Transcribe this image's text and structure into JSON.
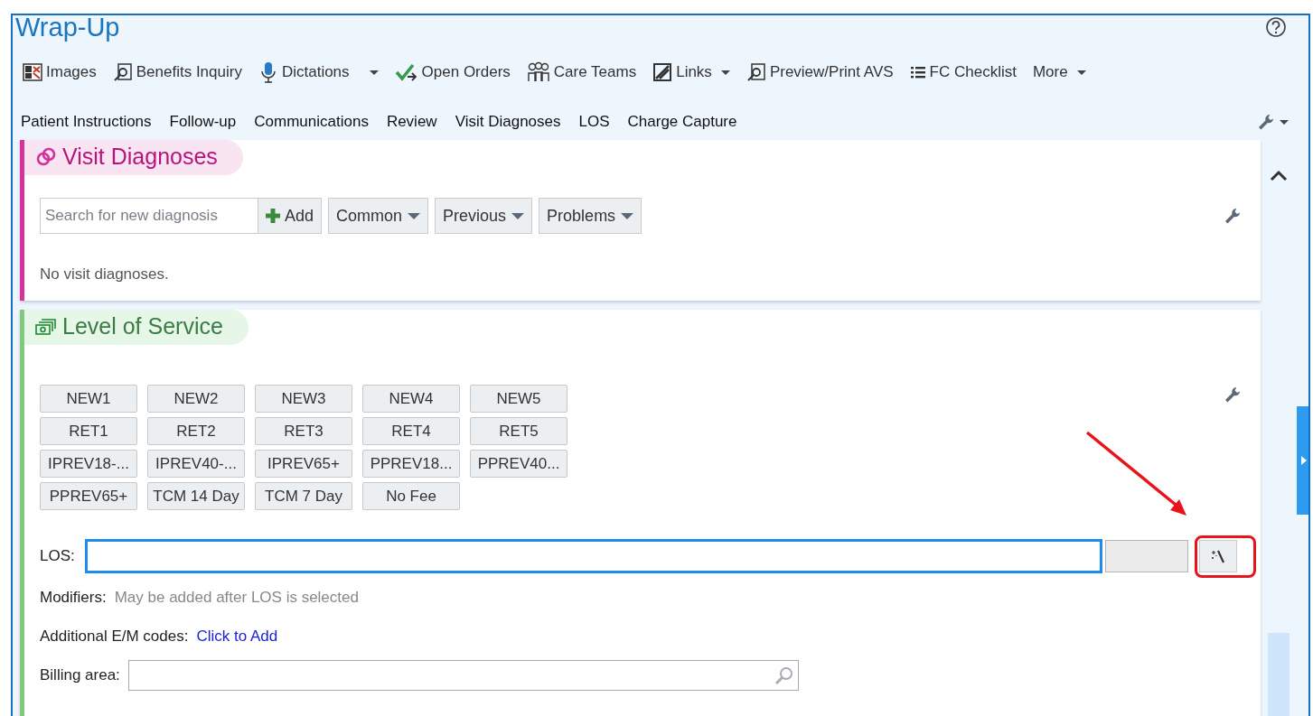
{
  "header": {
    "title": "Wrap-Up"
  },
  "toolbar": [
    {
      "label": "Images",
      "dropdown": false
    },
    {
      "label": "Benefits Inquiry",
      "dropdown": false
    },
    {
      "label": "Dictations",
      "dropdown": true
    },
    {
      "label": "Open Orders",
      "dropdown": false
    },
    {
      "label": "Care Teams",
      "dropdown": false
    },
    {
      "label": "Links",
      "dropdown": true
    },
    {
      "label": "Preview/Print AVS",
      "dropdown": false
    },
    {
      "label": "FC Checklist",
      "dropdown": false
    },
    {
      "label": "More",
      "dropdown": true
    }
  ],
  "nav_tabs": [
    "Patient Instructions",
    "Follow-up",
    "Communications",
    "Review",
    "Visit Diagnoses",
    "LOS",
    "Charge Capture"
  ],
  "visit_diagnoses": {
    "title": "Visit Diagnoses",
    "search": {
      "placeholder": "Search for new diagnosis"
    },
    "buttons": [
      {
        "label": "Add",
        "kind": "add"
      },
      {
        "label": "Common",
        "kind": "menu"
      },
      {
        "label": "Previous",
        "kind": "menu"
      },
      {
        "label": "Problems",
        "kind": "menu"
      }
    ],
    "empty_message": "No visit diagnoses."
  },
  "level_of_service": {
    "title": "Level of Service",
    "codes": [
      "NEW1",
      "NEW2",
      "NEW3",
      "NEW4",
      "NEW5",
      "RET1",
      "RET2",
      "RET3",
      "RET4",
      "RET5",
      "IPREV18-...",
      "IPREV40-...",
      "IPREV65+",
      "PPREV18...",
      "PPREV40...",
      "PPREV65+",
      "TCM 14 Day",
      "TCM 7 Day",
      "No Fee"
    ],
    "los": {
      "label": "LOS:",
      "focused": true
    },
    "modifiers": {
      "label": "Modifiers:",
      "hint": "May be added after LOS is selected"
    },
    "additional_codes": {
      "label": "Additional E/M codes:",
      "link": "Click to Add"
    },
    "billing_area": {
      "label": "Billing area:"
    }
  }
}
